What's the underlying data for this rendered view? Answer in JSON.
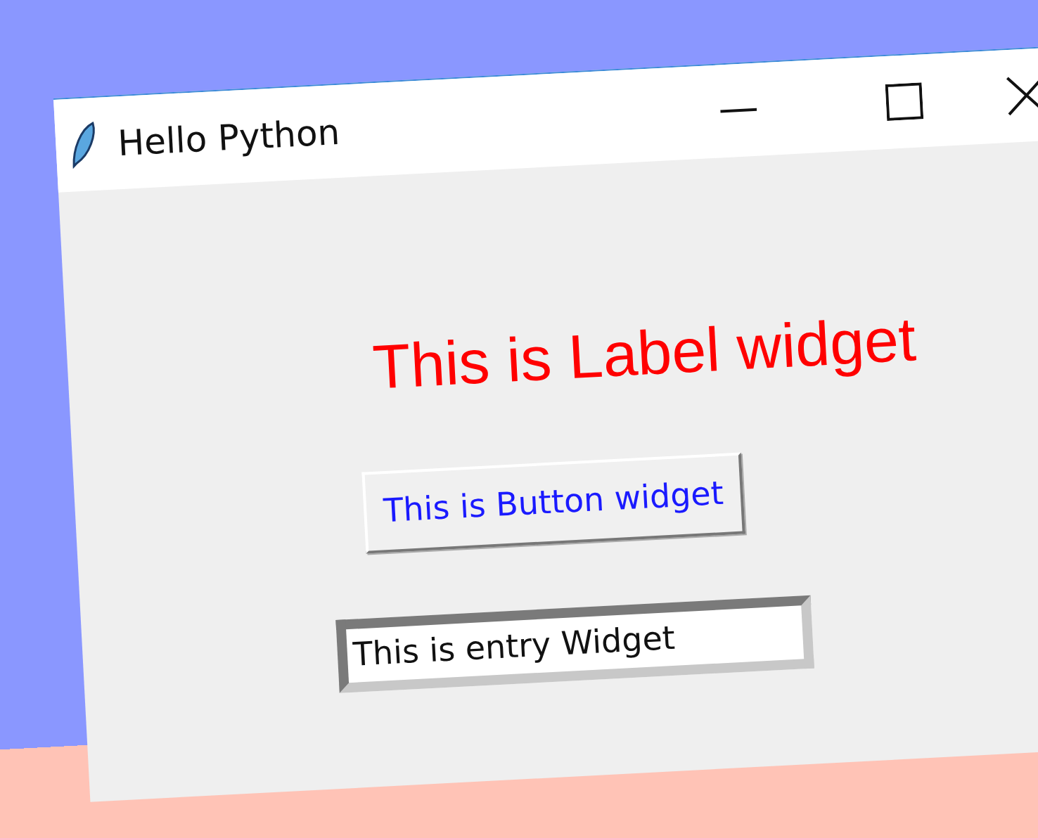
{
  "window": {
    "title": "Hello Python"
  },
  "label": {
    "text": "This is Label widget"
  },
  "button": {
    "label": "This is Button widget"
  },
  "entry": {
    "value": "This is entry Widget"
  }
}
